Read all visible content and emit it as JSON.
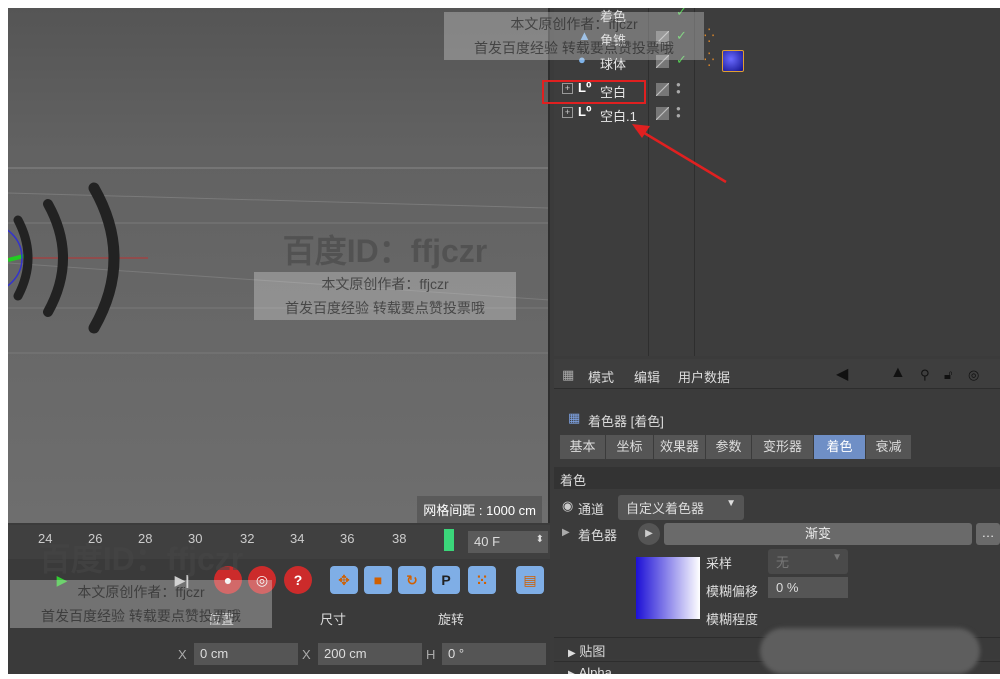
{
  "viewport": {
    "grid_spacing": "网格间距 : 1000 cm"
  },
  "timeline": {
    "ticks": [
      "24",
      "26",
      "28",
      "30",
      "32",
      "34",
      "36",
      "38"
    ],
    "frame_value": "40 F"
  },
  "coordinates": {
    "headers": {
      "position": "位置",
      "size": "尺寸",
      "rotation": "旋转"
    },
    "position_axis": "X",
    "position_value": "0 cm",
    "size_axis": "X",
    "size_value": "200 cm",
    "rotation_axis": "H",
    "rotation_value": "0 °"
  },
  "object_manager": {
    "objects": [
      {
        "name": "着色",
        "check": "✓"
      },
      {
        "name": "角锥",
        "check": "✓"
      },
      {
        "name": "球体",
        "check": "✓"
      },
      {
        "name": "空白"
      },
      {
        "name": "空白.1"
      }
    ]
  },
  "attributes": {
    "menu": [
      "模式",
      "编辑",
      "用户数据"
    ],
    "title": "着色器 [着色]",
    "tabs": [
      "基本",
      "坐标",
      "效果器",
      "参数",
      "变形器",
      "着色",
      "衰减"
    ],
    "active_tab": "着色",
    "section_title": "着色",
    "channel_label": "通道",
    "channel_value": "自定义着色器",
    "shader_label": "着色器",
    "gradient_label": "渐变",
    "sampling_label": "采样",
    "sampling_value": "无",
    "blur_offset_label": "模糊偏移",
    "blur_offset_value": "0 %",
    "blur_degree_label": "模糊程度",
    "texture_label": "贴图",
    "alpha_label": "Alpha"
  },
  "watermark": {
    "brand": "百度ID：ffjczr",
    "line1": "本文原创作者：ffjczr",
    "line2": "首发百度经验 转载要点赞投票哦"
  },
  "colors": {
    "accent_tab": "#6f8fc6",
    "highlight_box": "#e02020",
    "playhead": "#3bd67a"
  }
}
